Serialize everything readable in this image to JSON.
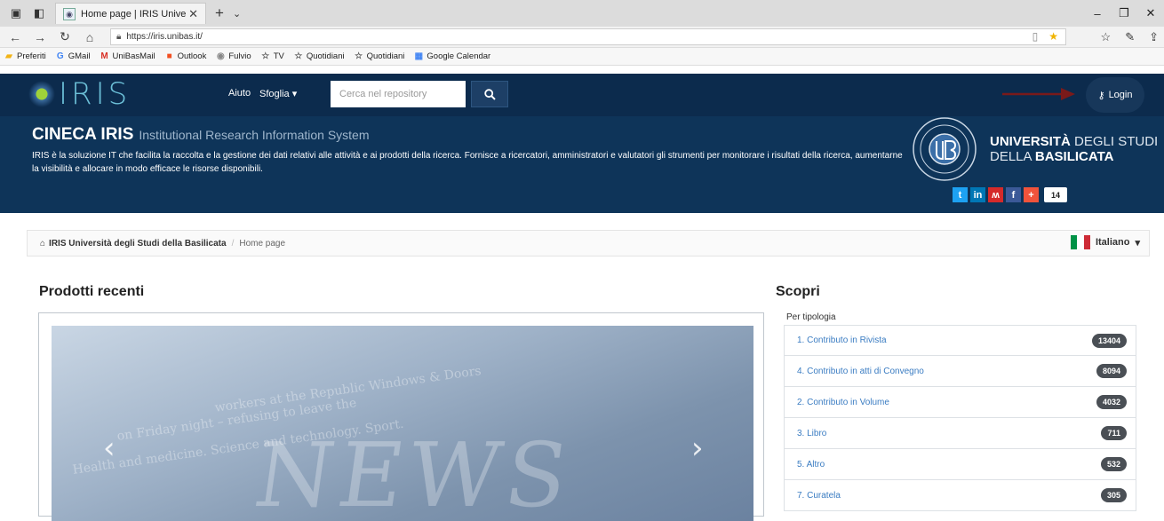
{
  "browser": {
    "tab_title": "Home page | IRIS Unive",
    "address": "https://iris.unibas.it/",
    "favorites": [
      {
        "label": "Preferiti",
        "icon": "folder-icon",
        "color": "#f2b316"
      },
      {
        "label": "GMail",
        "icon": "google-icon",
        "color": "#4285f4"
      },
      {
        "label": "UniBasMail",
        "icon": "gmail-icon",
        "color": "#d93025"
      },
      {
        "label": "Outlook",
        "icon": "windows-icon",
        "color": "#f25022"
      },
      {
        "label": "Fulvio",
        "icon": "globe-icon",
        "color": "#888888"
      },
      {
        "label": "TV",
        "icon": "star-icon",
        "color": "#555555"
      },
      {
        "label": "Quotidiani",
        "icon": "star-icon",
        "color": "#555555"
      },
      {
        "label": "Quotidiani",
        "icon": "star-icon",
        "color": "#555555"
      },
      {
        "label": "Google Calendar",
        "icon": "calendar-icon",
        "color": "#4285f4"
      }
    ]
  },
  "header": {
    "logo_text": "IRIS",
    "menu_aiuto": "Aiuto",
    "menu_sfoglia": "Sfoglia",
    "search_placeholder": "Cerca nel repository",
    "login_label": "Login",
    "title": "CINECA IRIS",
    "subtitle": "Institutional Research Information System",
    "description": "IRIS è la soluzione IT che facilita la raccolta e la gestione dei dati relativi alle attività e ai prodotti della ricerca. Fornisce a ricercatori, amministratori e valutatori gli strumenti per monitorare i risultati della ricerca, aumentarne la visibilità e allocare in modo efficace le risorse disponibili.",
    "uni_line1_bold": "UNIVERSITÀ",
    "uni_line1_light": "DEGLI STUDI",
    "uni_line2_light": "DELLA",
    "uni_line2_bold": "BASILICATA",
    "share_count": "14",
    "colors": {
      "top": "#0c2b4d",
      "main": "#0e3459"
    }
  },
  "breadcrumb": {
    "root": "IRIS Università degli Studi della Basilicata",
    "current": "Home page",
    "language": "Italiano"
  },
  "recent": {
    "heading": "Prodotti recenti"
  },
  "scopri": {
    "heading": "Scopri",
    "group": "Per tipologia",
    "items": [
      {
        "label": "1. Contributo in Rivista",
        "count": "13404"
      },
      {
        "label": "4. Contributo in atti di Convegno",
        "count": "8094"
      },
      {
        "label": "2. Contributo in Volume",
        "count": "4032"
      },
      {
        "label": "3. Libro",
        "count": "711"
      },
      {
        "label": "5. Altro",
        "count": "532"
      },
      {
        "label": "7. Curatela",
        "count": "305"
      }
    ]
  }
}
